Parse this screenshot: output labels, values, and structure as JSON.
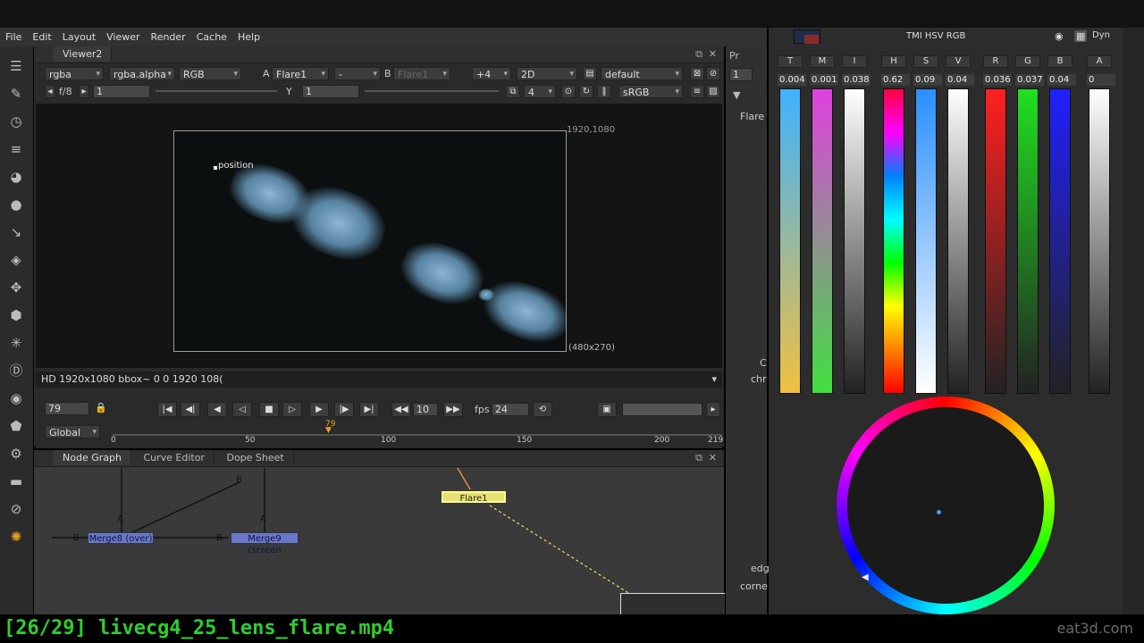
{
  "menu": [
    "File",
    "Edit",
    "Layout",
    "Viewer",
    "Render",
    "Cache",
    "Help"
  ],
  "viewer": {
    "tab": "Viewer2",
    "channels": "rgba",
    "alpha": "rgba.alpha",
    "colorspace_dd": "RGB",
    "input_a_label": "A",
    "input_a": "Flare1",
    "op": "-",
    "input_b_label": "B",
    "input_b": "Flare1",
    "zoom": "+4",
    "view_mode": "2D",
    "lut": "default",
    "fstop": "f/8",
    "gain": "1",
    "gamma_label": "Y",
    "gamma": "1",
    "proxy": "4",
    "display": "sRGB",
    "format_tr": "1920,1080",
    "format_br": "(480x270)",
    "position_label": "position",
    "status": "HD 1920x1080 bbox~ 0 0 1920 108("
  },
  "timeline": {
    "frame": "79",
    "step": "10",
    "fps_label": "fps",
    "fps": "24",
    "range": "Global",
    "ticks": [
      "0",
      "50",
      "100",
      "150",
      "200",
      "219"
    ],
    "marker": "79"
  },
  "nodegraph": {
    "tabs": [
      "Node Graph",
      "Curve Editor",
      "Dope Sheet"
    ],
    "nodes": {
      "merge8": "Merge8 (over)",
      "merge9": "Merge9 (screen",
      "flare": "Flare1"
    },
    "input_labels": {
      "a": "A",
      "b": "B"
    }
  },
  "properties": {
    "tab": "Pr",
    "value": "1",
    "label": "Flare",
    "c": "C",
    "chr": "chr",
    "edg": "edg",
    "corne": "corne"
  },
  "colorpanel": {
    "title": "TMI HSV RGB",
    "dyn": "Dyn",
    "channels": [
      {
        "label": "T",
        "value": "0.004",
        "c1": "#3fb2ff",
        "c2": "#f0c040"
      },
      {
        "label": "M",
        "value": "0.001",
        "c1": "#e040e0",
        "c2": "#40e040"
      },
      {
        "label": "I",
        "value": "0.038",
        "c1": "#ffffff",
        "c2": "#222222"
      },
      {
        "label": "H",
        "value": "0.62",
        "c1": "hue",
        "c2": ""
      },
      {
        "label": "S",
        "value": "0.09",
        "c1": "#2a8fff",
        "c2": "#ffffff"
      },
      {
        "label": "V",
        "value": "0.04",
        "c1": "#ffffff",
        "c2": "#222222"
      },
      {
        "label": "R",
        "value": "0.036",
        "c1": "#ff2020",
        "c2": "#222222"
      },
      {
        "label": "G",
        "value": "0.037",
        "c1": "#20e020",
        "c2": "#222222"
      },
      {
        "label": "B",
        "value": "0.04",
        "c1": "#2020ff",
        "c2": "#222222"
      },
      {
        "label": "A",
        "value": "0",
        "c1": "#ffffff",
        "c2": "#222222"
      }
    ]
  },
  "caption": "[26/29] livecg4_25_lens_flare.mp4",
  "watermark": "eat3d.com"
}
